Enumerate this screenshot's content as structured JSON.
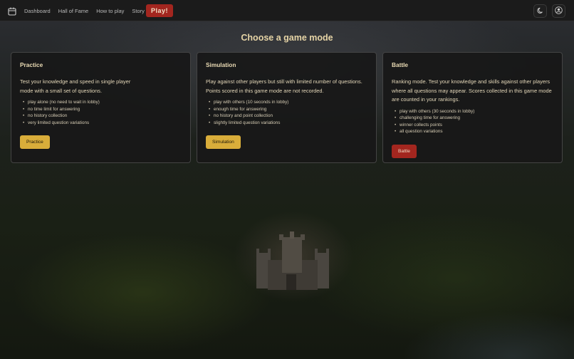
{
  "navbar": {
    "logo_icon": "calendar-icon",
    "links": [
      "Dashboard",
      "Hall of Fame",
      "How to play",
      "Story"
    ],
    "play_label": "Play!",
    "theme_icon": "moon-icon",
    "account_icon": "user-circle-icon"
  },
  "page": {
    "title": "Choose a game mode"
  },
  "cards": [
    {
      "title": "Practice",
      "description": "Test your knowledge and speed in single player mode with a small set of questions.",
      "features": [
        "play alone (no need to wait in lobby)",
        "no time limit for answering",
        "no history collection",
        "very limited question variations"
      ],
      "button": "Practice"
    },
    {
      "title": "Simulation",
      "description": "Play against other players but still with limited number of questions. Points scored in this game mode are not recorded.",
      "features": [
        "play with others (10 seconds in lobby)",
        "enough time for answering",
        "no history and point collection",
        "slightly limited question variations"
      ],
      "button": "Simulation"
    },
    {
      "title": "Battle",
      "description": "Ranking mode. Test your knowledge and skills against other players where all questions may appear. Scores collected in this game mode are counted in your rankings.",
      "features": [
        "play with others (30 seconds in lobby)",
        "challenging time for answering",
        "winner collects points",
        "all question variations"
      ],
      "button": "Battle"
    }
  ],
  "colors": {
    "gold": "#d9ad3a",
    "red": "#a3261f",
    "title": "#e6d4a6"
  }
}
